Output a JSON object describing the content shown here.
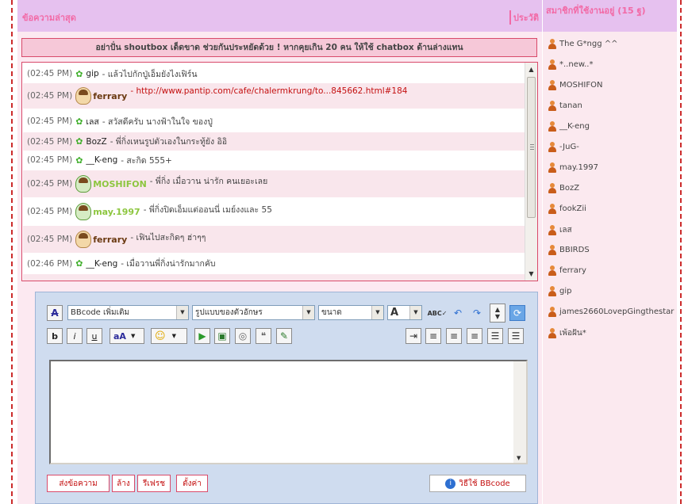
{
  "main": {
    "title": "ข้อความล่าสุด",
    "history_link": "ประวัติ",
    "notice": "อย่าปั่น shoutbox เด็ดขาด ช่วยกันประหยัดด้วย ! หากคุยเกิน 20 คน ให้ใช้ chatbox ด้านล่างแทน"
  },
  "messages": [
    {
      "time": "(02:45 PM)",
      "user": "gip",
      "text": "- แล้วไปกักปู่เอ็มยังไงเฟิร์น"
    },
    {
      "time": "(02:45 PM)",
      "user": "ferrary",
      "text": "- http://www.pantip.com/cafe/chalermkrung/to...845662.html#184"
    },
    {
      "time": "(02:45 PM)",
      "user": "เลส",
      "text": "- สวัสดีครับ นางฟ้าในใจ ของปู่"
    },
    {
      "time": "(02:45 PM)",
      "user": "BozZ",
      "text": "- พี่กิ่งเหนรูปตัวเองในกระทู้ยัง อิอิ"
    },
    {
      "time": "(02:45 PM)",
      "user": "__K-eng",
      "text": "- สะกิด 555+"
    },
    {
      "time": "(02:45 PM)",
      "user": "MOSHIFON",
      "text": "- พี่กิ่ง เมื่อวาน น่ารัก คนเยอะเลย"
    },
    {
      "time": "(02:45 PM)",
      "user": "may.1997",
      "text": "- พี่กิ่งปิดเอ็มแต่ออนนี่ เมย์งงและ 55"
    },
    {
      "time": "(02:45 PM)",
      "user": "ferrary",
      "text": "- เฟินไปสะกิดๆ ฮ่าๆๆ"
    },
    {
      "time": "(02:46 PM)",
      "user": "__K-eng",
      "text": "- เมื่อวานพี่กิ่งน่ารักมากคับ"
    }
  ],
  "editor": {
    "bbcode_select": "BBcode เพิ่มเติม",
    "font_select": "รูปแบบของตัวอักษร",
    "size_select": "ขนาด",
    "color_select": "A",
    "buttons": {
      "send": "ส่งข้อความ",
      "clear": "ล้าง",
      "refresh": "รีเฟรช",
      "settings": "ตั้งค่า",
      "bbcode_help": "วิธีใช้ BBcode"
    }
  },
  "sidebar": {
    "title": "สมาชิกที่ใช้งานอยู่ (15 ฐ)",
    "members": [
      "The G*ngg ^^",
      "*..new..*",
      "MOSHIFON",
      "tanan",
      "__K-eng",
      "-JuG-",
      "may.1997",
      "BozZ",
      "fookZii",
      "เลส",
      "BBIRDS",
      "ferrary",
      "gip",
      "james2660LovepGingthestar",
      "เพ้อฝัน*"
    ]
  },
  "colors": {
    "accent_pink": "#f26aa6",
    "header_lilac": "#e6c1ef",
    "panel_pink": "#fce9f1",
    "border_red": "#d94a6a",
    "link_red": "#c41010",
    "editor_blue": "#cfdcef"
  }
}
